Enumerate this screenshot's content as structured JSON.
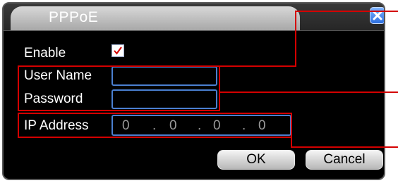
{
  "dialog": {
    "title": "PPPoE",
    "close_icon": "close-x-icon"
  },
  "form": {
    "enable_label": "Enable",
    "enable_checked": true,
    "username_label": "User Name",
    "username_value": "",
    "password_label": "Password",
    "password_value": "",
    "ip_label": "IP Address",
    "ip_octets": [
      "0",
      "0",
      "0",
      "0"
    ],
    "ip_dot": "."
  },
  "buttons": {
    "ok_label": "OK",
    "cancel_label": "Cancel"
  },
  "colors": {
    "annotation": "#d40000",
    "field_border": "#4a7fd0",
    "close_button": "#2d6fe0"
  }
}
